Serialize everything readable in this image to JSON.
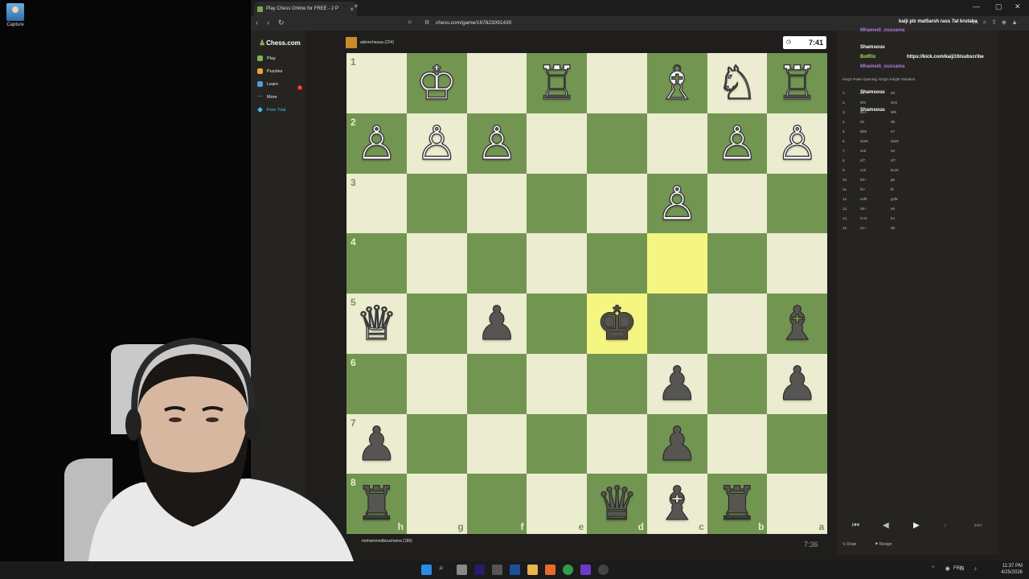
{
  "desktop": {
    "icon_label": "Capture"
  },
  "browser": {
    "tab_title": "Play Chess Online for FREE - 2 P",
    "url": "chess.com/game/167823091430"
  },
  "sidebar": {
    "logo": "Chess.com",
    "items": [
      {
        "label": "Play",
        "color": "#81b64c"
      },
      {
        "label": "Puzzles",
        "color": "#e8a33c"
      },
      {
        "label": "Learn",
        "color": "#4aa0d8"
      },
      {
        "label": "More",
        "color": "#888888"
      },
      {
        "label": "Free Trial",
        "color": "#3ec0e8"
      }
    ],
    "play_badge": "1"
  },
  "players": {
    "top": {
      "name": "ademchaoua",
      "rating": "(224)"
    },
    "bottom": {
      "name": "mohammedbouchama",
      "rating": "(189)"
    }
  },
  "clocks": {
    "top": "7:41",
    "bottom": "7:36"
  },
  "board": {
    "files_bottom": [
      "h",
      "g",
      "f",
      "e",
      "d",
      "c",
      "b",
      "a"
    ],
    "ranks_left": [
      "1",
      "2",
      "3",
      "4",
      "5",
      "6",
      "7",
      "8"
    ],
    "highlight_squares": [
      [
        4,
        4
      ],
      [
        3,
        5
      ]
    ],
    "pieces": [
      {
        "r": 0,
        "c": 1,
        "g": "♔",
        "side": "w"
      },
      {
        "r": 0,
        "c": 3,
        "g": "♖",
        "side": "w"
      },
      {
        "r": 0,
        "c": 5,
        "g": "♗",
        "side": "w"
      },
      {
        "r": 0,
        "c": 6,
        "g": "♘",
        "side": "w"
      },
      {
        "r": 0,
        "c": 7,
        "g": "♖",
        "side": "w"
      },
      {
        "r": 1,
        "c": 0,
        "g": "♙",
        "side": "w"
      },
      {
        "r": 1,
        "c": 1,
        "g": "♙",
        "side": "w"
      },
      {
        "r": 1,
        "c": 2,
        "g": "♙",
        "side": "w"
      },
      {
        "r": 1,
        "c": 6,
        "g": "♙",
        "side": "w"
      },
      {
        "r": 1,
        "c": 7,
        "g": "♙",
        "side": "w"
      },
      {
        "r": 2,
        "c": 5,
        "g": "♙",
        "side": "w"
      },
      {
        "r": 4,
        "c": 0,
        "g": "♕",
        "side": "w"
      },
      {
        "r": 4,
        "c": 2,
        "g": "♟",
        "side": "b"
      },
      {
        "r": 4,
        "c": 4,
        "g": "♚",
        "side": "b"
      },
      {
        "r": 4,
        "c": 7,
        "g": "♝",
        "side": "b"
      },
      {
        "r": 5,
        "c": 5,
        "g": "♟",
        "side": "b"
      },
      {
        "r": 5,
        "c": 7,
        "g": "♟",
        "side": "b"
      },
      {
        "r": 6,
        "c": 0,
        "g": "♟",
        "side": "b"
      },
      {
        "r": 6,
        "c": 5,
        "g": "♟",
        "side": "b"
      },
      {
        "r": 7,
        "c": 0,
        "g": "♜",
        "side": "b"
      },
      {
        "r": 7,
        "c": 4,
        "g": "♛",
        "side": "b"
      },
      {
        "r": 7,
        "c": 5,
        "g": "♝",
        "side": "b"
      },
      {
        "r": 7,
        "c": 6,
        "g": "♜",
        "side": "b"
      }
    ]
  },
  "panel": {
    "opening": "King's Pawn Opening: King's Knight Variation",
    "chat": [
      {
        "user": "kaiji plz mat5arsh rass 7at krutaba",
        "color": "#ffffff"
      },
      {
        "user": "Mhamedi_oussama",
        "color": "#b07ad8"
      },
      {
        "user": "Shamsouu",
        "color": "#ffffff"
      },
      {
        "user": "BotRix",
        "color": "#9be26b"
      },
      {
        "user": "https://kick.com/kaiji16/subscribe",
        "color": "#ffffff"
      },
      {
        "user": "Mhamedi_oussama",
        "color": "#b07ad8"
      },
      {
        "user": "Shamsouu",
        "color": "#ffffff"
      },
      {
        "user": "Shamsouu",
        "color": "#ffffff"
      }
    ],
    "moves": [
      {
        "n": "1.",
        "w": "e4",
        "b": "e5"
      },
      {
        "n": "2.",
        "w": "Nf3",
        "b": "Nc6"
      },
      {
        "n": "3.",
        "w": "Bc4",
        "b": "Nf6"
      },
      {
        "n": "4.",
        "w": "d4",
        "b": "d5"
      },
      {
        "n": "5.",
        "w": "Bb5",
        "b": "e7"
      },
      {
        "n": "6.",
        "w": "dxe5",
        "b": "dxe5"
      },
      {
        "n": "7.",
        "w": "xe5",
        "b": "e6"
      },
      {
        "n": "8.",
        "w": "xf7",
        "b": "xf7"
      },
      {
        "n": "9.",
        "w": "xc6",
        "b": "bxc6"
      },
      {
        "n": "10.",
        "w": "h5+",
        "b": "g6"
      },
      {
        "n": "11.",
        "w": "f3+",
        "b": "f5"
      },
      {
        "n": "12.",
        "w": "exf5",
        "b": "gxf5"
      },
      {
        "n": "13.",
        "w": "h5+",
        "b": "e6"
      },
      {
        "n": "14.",
        "w": "O-O",
        "b": "b4"
      },
      {
        "n": "15.",
        "w": "e1+",
        "b": "d5"
      }
    ],
    "draw": "Draw",
    "resign": "Resign"
  },
  "tray": {
    "lang": "FRA",
    "time": "11:37 PM",
    "date": "4/25/2026"
  }
}
